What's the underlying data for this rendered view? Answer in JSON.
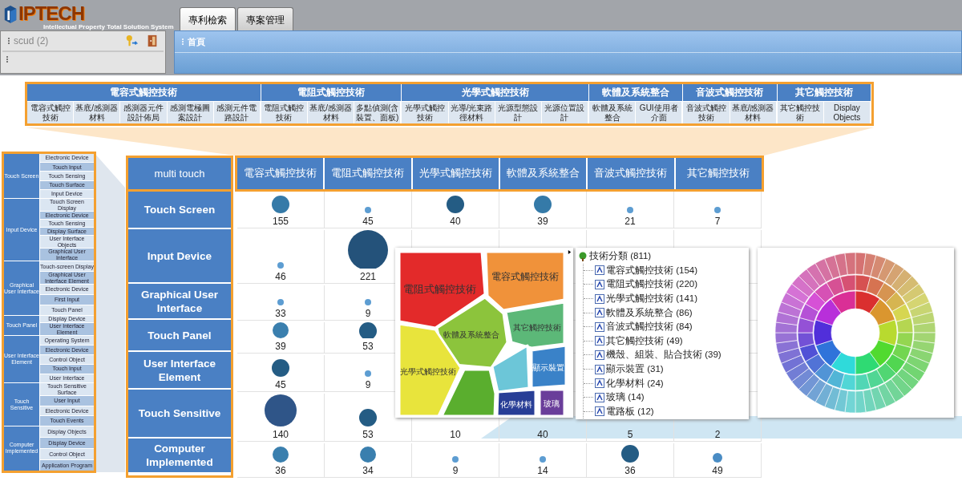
{
  "header": {
    "logo": "IPTECH",
    "tagline": "Intellectual Property Total Solution System",
    "tabs": [
      {
        "label": "專利檢索",
        "selected": true
      },
      {
        "label": "專案管理",
        "selected": false
      }
    ],
    "user": "scud (2)",
    "breadcrumb": "首頁"
  },
  "taxonomy": {
    "groups": [
      {
        "label": "電容式觸控技術",
        "items": [
          "電容式觸控技術",
          "基底/感測器材料",
          "感測器元件設計佈局",
          "感測電極圖案設計",
          "感測元件電路設計"
        ]
      },
      {
        "label": "電阻式觸控技術",
        "items": [
          "電阻式觸控技術",
          "基底/感測器材料",
          "多點偵測(含裝置、面板)"
        ]
      },
      {
        "label": "光學式觸控技術",
        "items": [
          "光學式觸控技術",
          "光導/光束路徑材料",
          "光源型態設計",
          "光源位置設計"
        ]
      },
      {
        "label": "軟體及系統整合",
        "items": [
          "軟體及系統整合",
          "GUI使用者介面"
        ]
      },
      {
        "label": "音波式觸控技術",
        "items": [
          "音波式觸控技術",
          "基底/感測器材料"
        ]
      },
      {
        "label": "其它觸控技術",
        "items": [
          "其它觸控技術",
          "Display Objects"
        ]
      }
    ]
  },
  "outline": {
    "groups": [
      {
        "label": "Touch Screen",
        "items": [
          "Electronic Device",
          "Touch Input",
          "Touch Sensing",
          "Touch Surface",
          "Input Device"
        ]
      },
      {
        "label": "Input Device",
        "items": [
          "Touch Screen Display",
          "Electronic Device",
          "Touch Sensing",
          "Display Surface",
          "User Interface Objects",
          "Graphical User Interface"
        ]
      },
      {
        "label": "Graphical User Interface",
        "items": [
          "Touch-screen Display",
          "Graphical User Interface Element",
          "Electronic Device",
          "First Input",
          "Touch Panel"
        ]
      },
      {
        "label": "Touch Panel",
        "items": [
          "Display Device",
          "User Interface Element"
        ]
      },
      {
        "label": "User Interface Element",
        "items": [
          "Operating System",
          "Electronic Device",
          "Control Object",
          "Touch Input",
          "User Interface"
        ]
      },
      {
        "label": "Touch Sensitive",
        "items": [
          "Touch Sensitive Surface",
          "User Input",
          "Electronic Device",
          "Touch Events"
        ]
      },
      {
        "label": "Computer Implemented",
        "items": [
          "Display Objects",
          "Display Device",
          "Control Object",
          "Application Program"
        ]
      }
    ]
  },
  "matrix": {
    "corner": "multi touch",
    "columns": [
      "電容式觸控技術",
      "電阻式觸控技術",
      "光學式觸控技術",
      "軟體及系統整合",
      "音波式觸控技術",
      "其它觸控技術"
    ],
    "rows": [
      {
        "label": "Touch Screen",
        "cells": [
          {
            "count": "155",
            "kind": "large"
          },
          {
            "count": "45",
            "kind": "tiny"
          },
          {
            "count": "40",
            "kind": "dark"
          },
          {
            "count": "39",
            "kind": "large"
          },
          {
            "count": "21",
            "kind": "tiny"
          },
          {
            "count": "7",
            "kind": "tiny"
          }
        ]
      },
      {
        "label": "Input Device",
        "cells": [
          {
            "count": "46",
            "kind": "tiny"
          },
          {
            "count": "221",
            "kind": "huge"
          },
          {},
          {},
          {},
          {}
        ]
      },
      {
        "label": "Graphical User Interface",
        "cells": [
          {
            "count": "33",
            "kind": "tiny"
          },
          {
            "count": "9",
            "kind": "tiny"
          },
          {},
          {},
          {},
          {}
        ]
      },
      {
        "label": "Touch Panel",
        "cells": [
          {
            "count": "39",
            "kind": "medium"
          },
          {
            "count": "53",
            "kind": "dark"
          },
          {},
          {},
          {},
          {}
        ]
      },
      {
        "label": "User Interface Element",
        "cells": [
          {
            "count": "45",
            "kind": "dark"
          },
          {
            "count": "9",
            "kind": "tiny"
          },
          {},
          {},
          {},
          {}
        ]
      },
      {
        "label": "Touch Sensitive",
        "cells": [
          {
            "count": "140",
            "kind": "giant"
          },
          {
            "count": "53",
            "kind": "dark"
          },
          {
            "count": "10"
          },
          {
            "count": "40"
          },
          {
            "count": "5"
          },
          {
            "count": "2"
          }
        ]
      },
      {
        "label": "Computer Implemented",
        "cells": [
          {
            "count": "36",
            "kind": "medium"
          },
          {
            "count": "34",
            "kind": "medium"
          },
          {
            "count": "9",
            "kind": "tiny"
          },
          {
            "count": "14",
            "kind": "tiny"
          },
          {
            "count": "36",
            "kind": "dark"
          },
          {
            "count": "49",
            "kind": "small"
          }
        ]
      }
    ]
  },
  "voronoi": {
    "regions": [
      {
        "label": "電阻式觸控技術",
        "color": "#e32a2a"
      },
      {
        "label": "電容式觸控技術",
        "color": "#f0923a"
      },
      {
        "label": "軟體及系統整合",
        "color": "#8cc43c"
      },
      {
        "label": "其它觸控技術",
        "color": "#5cb878"
      },
      {
        "label": "光學式觸控技術",
        "color": "#e8e43c"
      },
      {
        "color": "#5aae2e"
      },
      {
        "color": "#6cc6d8"
      },
      {
        "label": "顯示裝置",
        "color": "#3a82c8"
      },
      {
        "label": "化學材料",
        "color": "#283e96"
      },
      {
        "label": "玻璃",
        "color": "#6a3e9a"
      }
    ]
  },
  "tree": {
    "label": "技術分類 (811)",
    "children": [
      {
        "label": "電容式觸控技術 (154)"
      },
      {
        "label": "電阻式觸控技術 (220)"
      },
      {
        "label": "光學式觸控技術 (141)"
      },
      {
        "label": "軟體及系統整合 (86)"
      },
      {
        "label": "音波式觸控技術 (84)"
      },
      {
        "label": "其它觸控技術 (49)"
      },
      {
        "label": "機殼、組裝、貼合技術 (39)"
      },
      {
        "label": "顯示裝置 (31)"
      },
      {
        "label": "化學材料 (24)"
      },
      {
        "label": "玻璃 (14)"
      },
      {
        "label": "電路板 (12)"
      }
    ]
  }
}
